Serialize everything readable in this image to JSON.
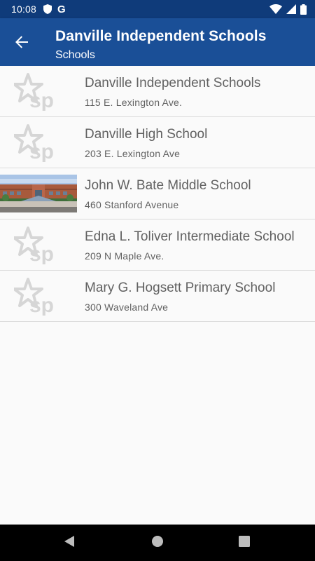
{
  "status_bar": {
    "time": "10:08",
    "left_icons": [
      "shield-icon",
      "google-g-icon"
    ],
    "right_icons": [
      "wifi-icon",
      "cell-signal-icon",
      "battery-icon"
    ],
    "g_letter": "G"
  },
  "app_bar": {
    "title": "Danville Independent Schools",
    "subtitle": "Schools",
    "back_icon": "back-arrow-icon"
  },
  "schools": [
    {
      "name": "Danville Independent Schools",
      "address": "115 E. Lexington Ave.",
      "thumbnail": "sp-logo-placeholder"
    },
    {
      "name": "Danville High School",
      "address": "203 E. Lexington Ave",
      "thumbnail": "sp-logo-placeholder"
    },
    {
      "name": "John W. Bate Middle School",
      "address": "460 Stanford Avenue",
      "thumbnail": "school-building-photo"
    },
    {
      "name": "Edna L. Toliver Intermediate School",
      "address": "209 N Maple Ave.",
      "thumbnail": "sp-logo-placeholder"
    },
    {
      "name": "Mary G. Hogsett Primary School",
      "address": "300 Waveland Ave",
      "thumbnail": "sp-logo-placeholder"
    }
  ],
  "nav_bar": {
    "buttons": [
      "back-triangle-icon",
      "home-circle-icon",
      "recents-square-icon"
    ]
  },
  "colors": {
    "status_bar": "#0f3b7a",
    "app_bar": "#1a4f97",
    "text_primary": "#616161",
    "divider": "#dcdcdc",
    "placeholder_logo": "#d6d6d6"
  },
  "placeholder_logo_text": "sp"
}
